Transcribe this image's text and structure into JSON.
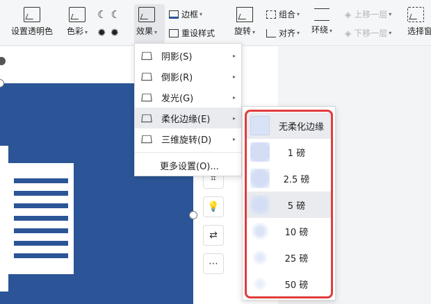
{
  "toolbar": {
    "set_transparent": "设置透明色",
    "color": "色彩",
    "effects": "效果",
    "border": "边框",
    "reset_style": "重设样式",
    "rotate": "旋转",
    "group": "组合",
    "align": "对齐",
    "wrap": "环绕",
    "bring_forward": "上移一层",
    "send_backward": "下移一层",
    "selection_pane": "选择窗"
  },
  "effects_menu": {
    "items": [
      {
        "label": "阴影(S)"
      },
      {
        "label": "倒影(R)"
      },
      {
        "label": "发光(G)"
      },
      {
        "label": "柔化边缘(E)"
      },
      {
        "label": "三维旋转(D)"
      }
    ],
    "more": "更多设置(O)..."
  },
  "soft_edge_menu": {
    "items": [
      {
        "label": "无柔化边缘"
      },
      {
        "label": "1 磅"
      },
      {
        "label": "2.5 磅"
      },
      {
        "label": "5 磅"
      },
      {
        "label": "10 磅"
      },
      {
        "label": "25 磅"
      },
      {
        "label": "50 磅"
      }
    ]
  },
  "colors": {
    "image_blue": "#2b5597",
    "highlight_red": "#e23b3b",
    "menu_hover": "#e9ebef"
  },
  "icons": {
    "more": "⋯"
  }
}
